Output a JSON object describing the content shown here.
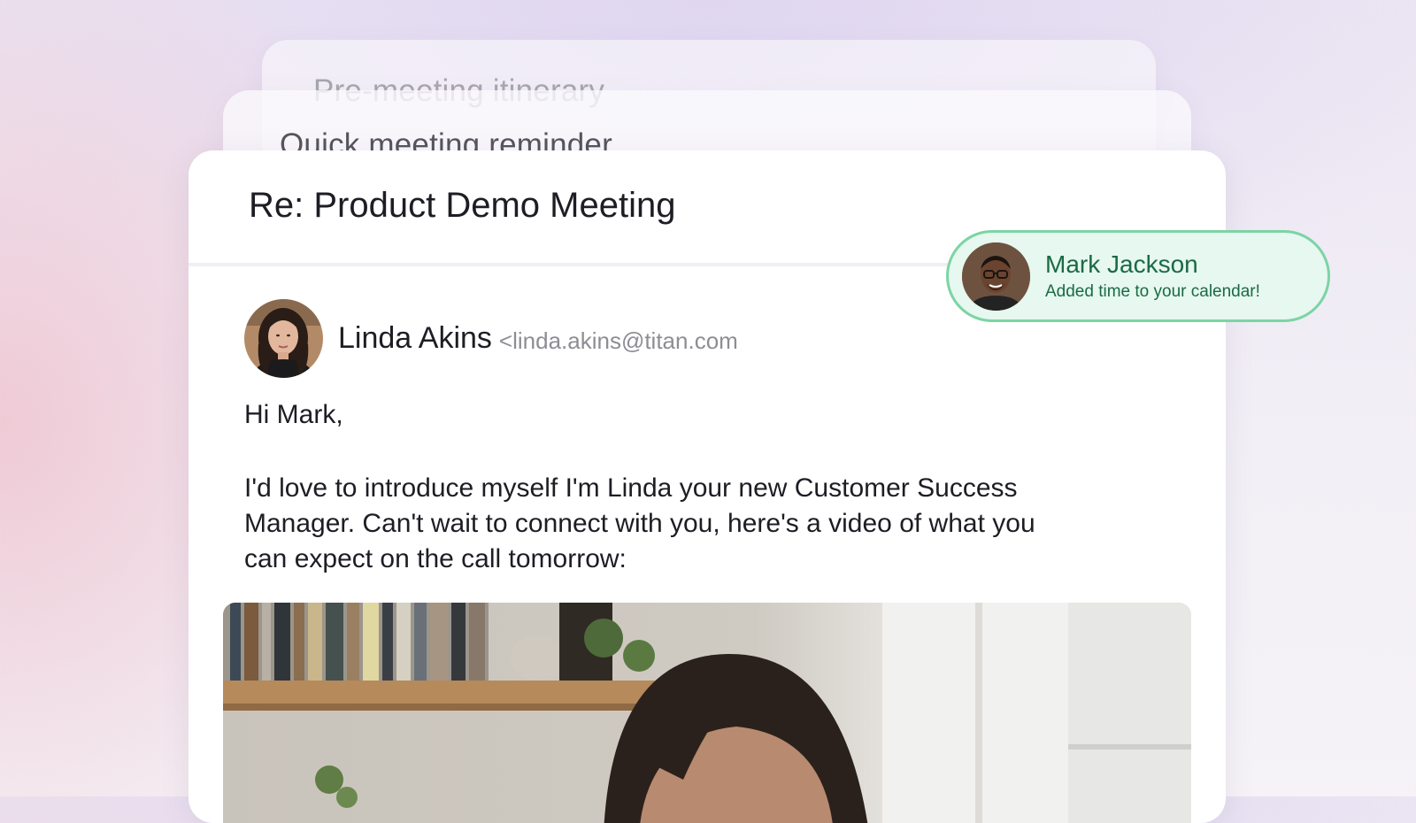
{
  "stack": {
    "back_title": "Pre-meeting itinerary",
    "mid_title": "Quick meeting reminder"
  },
  "email": {
    "subject": "Re: Product Demo Meeting",
    "sender_name": "Linda Akins",
    "sender_email": "<linda.akins@titan.com",
    "greeting": "Hi Mark,",
    "body_lines": [
      "I'd love to introduce myself I'm Linda your new Customer Success",
      "Manager. Can't wait to connect with you, here's a video of what you",
      "can expect on the call tomorrow:"
    ]
  },
  "notification": {
    "name": "Mark Jackson",
    "message": "Added time to your calendar!"
  },
  "colors": {
    "notification_bg": "#e6f8ef",
    "notification_border": "#7cd4a4",
    "notification_text": "#1b6a44",
    "text_primary": "#1d1d24",
    "text_muted": "#8d8d94"
  },
  "icons": {
    "sender_avatar": "avatar-linda-photo",
    "notification_avatar": "avatar-mark-photo",
    "video_thumbnail": "video-thumbnail-photo"
  }
}
